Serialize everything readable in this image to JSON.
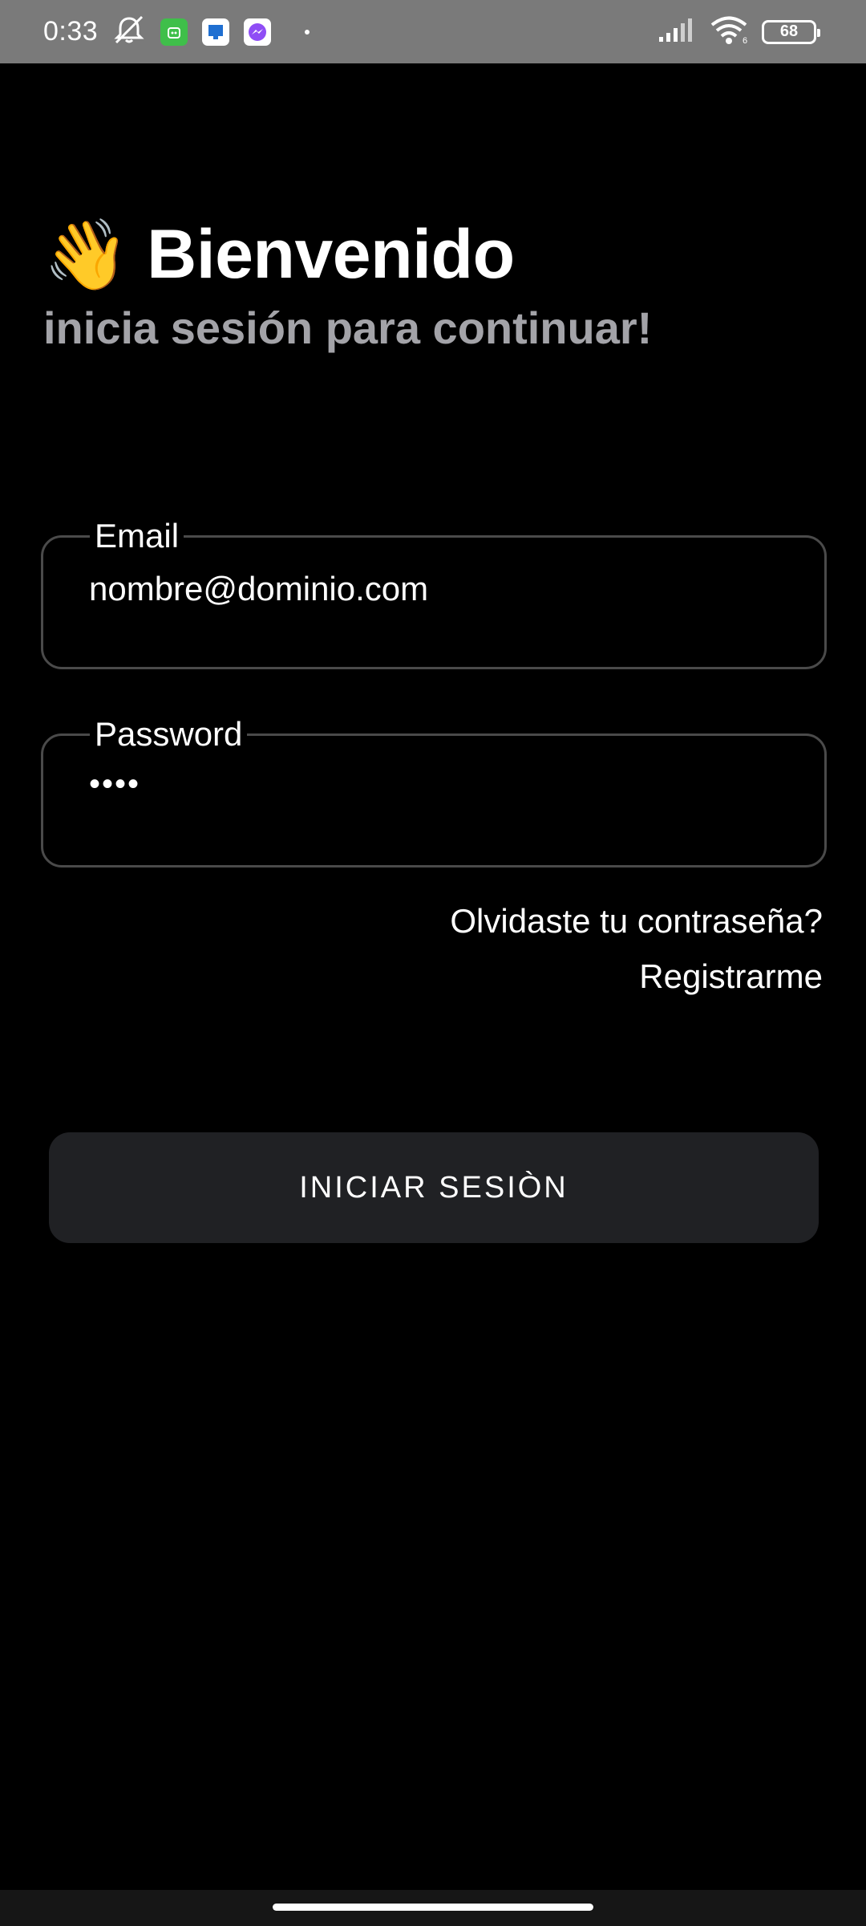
{
  "status_bar": {
    "time": "0:33",
    "icons": [
      "bell-off-icon",
      "app-green-icon",
      "app-blue-icon",
      "messenger-icon"
    ],
    "battery": "68",
    "wifi_badge": "6"
  },
  "header": {
    "wave_emoji": "👋",
    "title": "Bienvenido",
    "subtitle": "inicia sesión para continuar!"
  },
  "form": {
    "email_label": "Email",
    "email_value": "nombre@dominio.com",
    "password_label": "Password",
    "password_value": "••••",
    "forgot_link": "Olvidaste tu contraseña?",
    "register_link": "Registrarme",
    "submit_label": "INICIAR SESIÒN"
  },
  "colors": {
    "background": "#000000",
    "status_bar": "#7a7a7a",
    "subtitle": "#a3a3a8",
    "field_border": "#4a4a4a",
    "button_bg": "#202124"
  }
}
